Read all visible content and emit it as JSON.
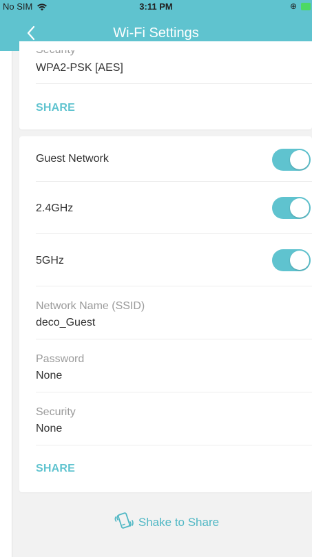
{
  "status_bar": {
    "carrier": "No SIM",
    "time": "3:11 PM",
    "accent_battery": "#4cd964"
  },
  "header": {
    "title": "Wi-Fi Settings",
    "back_icon": "chevron-left-icon",
    "color": "#5fc3cf"
  },
  "main_network": {
    "security_label": "Security",
    "security_value": "WPA2-PSK [AES]",
    "share_label": "SHARE"
  },
  "guest_network": {
    "title": "Guest Network",
    "enabled": true,
    "bands": [
      {
        "label": "2.4GHz",
        "enabled": true
      },
      {
        "label": "5GHz",
        "enabled": true
      }
    ],
    "ssid_label": "Network Name (SSID)",
    "ssid_value": "deco_Guest",
    "password_label": "Password",
    "password_value": "None",
    "security_label": "Security",
    "security_value": "None",
    "share_label": "SHARE"
  },
  "footer": {
    "shake_label": "Shake to Share",
    "shake_icon": "shake-phone-icon"
  }
}
